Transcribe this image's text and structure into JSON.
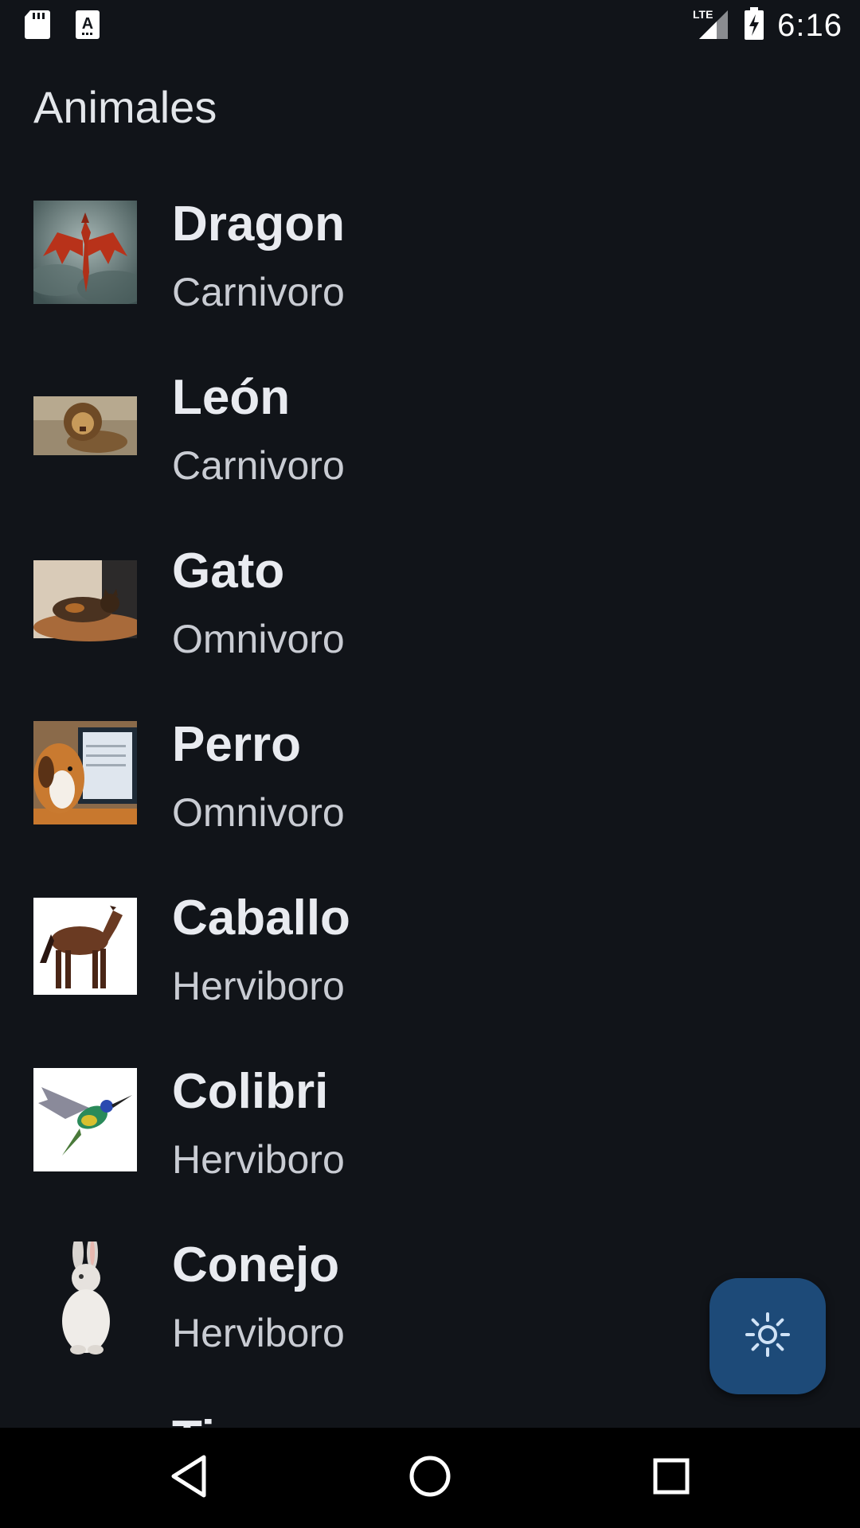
{
  "status_bar": {
    "time": "6:16",
    "network": "LTE",
    "icons": [
      "sd-card-icon",
      "keyboard-a-icon",
      "lte-signal-icon",
      "battery-charging-icon"
    ]
  },
  "app": {
    "title": "Animales"
  },
  "animals": [
    {
      "name": "Dragon",
      "diet": "Carnivoro",
      "image": "dragon"
    },
    {
      "name": "León",
      "diet": "Carnivoro",
      "image": "lion"
    },
    {
      "name": "Gato",
      "diet": "Omnivoro",
      "image": "cat"
    },
    {
      "name": "Perro",
      "diet": "Omnivoro",
      "image": "dog"
    },
    {
      "name": "Caballo",
      "diet": "Herviboro",
      "image": "horse"
    },
    {
      "name": "Colibri",
      "diet": "Herviboro",
      "image": "hummingbird"
    },
    {
      "name": "Conejo",
      "diet": "Herviboro",
      "image": "rabbit"
    },
    {
      "name": "Tigre",
      "diet": "",
      "image": "tiger"
    }
  ],
  "fab": {
    "icon": "brightness-icon"
  },
  "colors": {
    "background": "#111419",
    "fab": "#1d4a78",
    "nav_bar": "#000000"
  }
}
